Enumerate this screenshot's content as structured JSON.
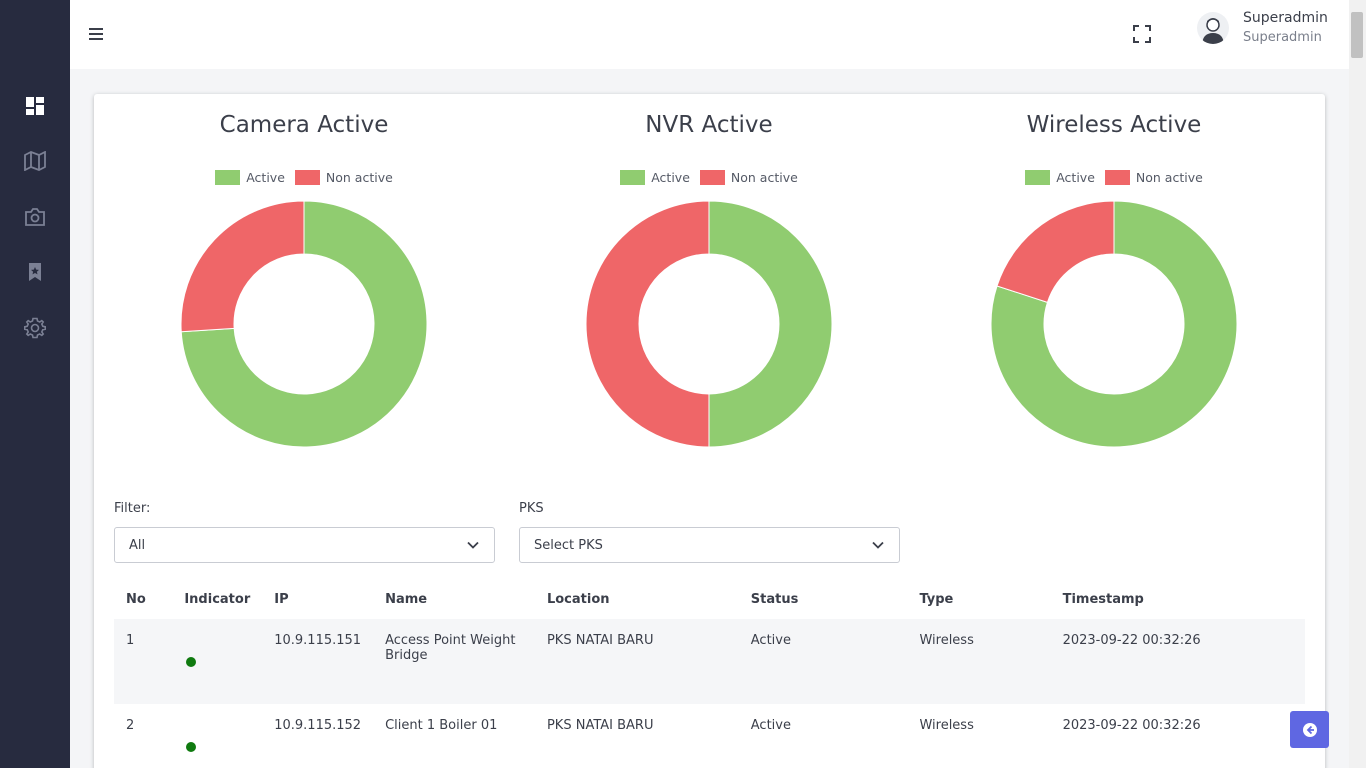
{
  "header": {
    "user_name": "Superadmin",
    "user_role": "Superadmin"
  },
  "sidebar": {
    "items": [
      {
        "icon": "dashboard-icon"
      },
      {
        "icon": "map-icon"
      },
      {
        "icon": "camera-icon"
      },
      {
        "icon": "bookmark-icon"
      },
      {
        "icon": "gear-icon"
      }
    ]
  },
  "colors": {
    "active": "#90cc70",
    "non_active": "#ef6668",
    "sidebar": "#272b3f",
    "accent": "#5f67e2",
    "indicator": "#0f7a0f"
  },
  "chart_data": [
    {
      "type": "pie",
      "title": "Camera Active",
      "legend": [
        "Active",
        "Non active"
      ],
      "categories": [
        "Active",
        "Non active"
      ],
      "values": [
        74,
        26
      ]
    },
    {
      "type": "pie",
      "title": "NVR Active",
      "legend": [
        "Active",
        "Non active"
      ],
      "categories": [
        "Active",
        "Non active"
      ],
      "values": [
        50,
        50
      ]
    },
    {
      "type": "pie",
      "title": "Wireless Active",
      "legend": [
        "Active",
        "Non active"
      ],
      "categories": [
        "Active",
        "Non active"
      ],
      "values": [
        80,
        20
      ]
    }
  ],
  "filters": {
    "filter_label": "Filter:",
    "filter_value": "All",
    "pks_label": "PKS",
    "pks_value": "Select PKS"
  },
  "table": {
    "columns": [
      "No",
      "Indicator",
      "IP",
      "Name",
      "Location",
      "Status",
      "Type",
      "Timestamp"
    ],
    "rows": [
      {
        "no": "1",
        "ip": "10.9.115.151",
        "name": "Access Point Weight Bridge",
        "location": "PKS NATAI BARU",
        "status": "Active",
        "type": "Wireless",
        "timestamp": "2023-09-22 00:32:26"
      },
      {
        "no": "2",
        "ip": "10.9.115.152",
        "name": "Client 1 Boiler 01",
        "location": "PKS NATAI BARU",
        "status": "Active",
        "type": "Wireless",
        "timestamp": "2023-09-22 00:32:26"
      }
    ]
  }
}
